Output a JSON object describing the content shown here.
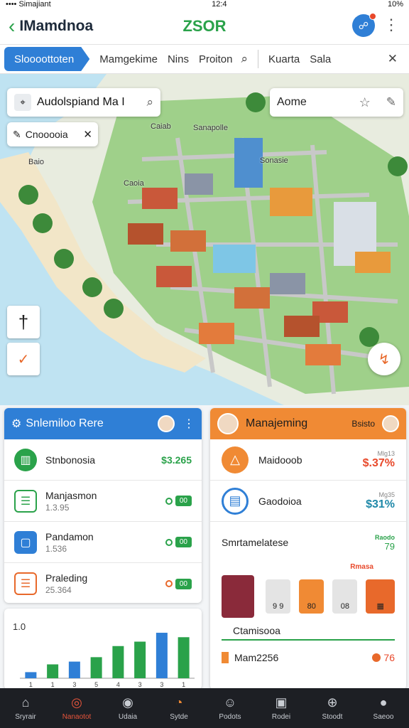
{
  "status_bar": {
    "carrier": "•••• Simajiant",
    "time": "12:4",
    "battery": "10%"
  },
  "app_bar": {
    "title": "IMamdnoa",
    "center_title": "ZSOR"
  },
  "tabs": {
    "active": "Sloooottoten",
    "items": [
      "Mamgekime",
      "Nins",
      "Proiton"
    ],
    "extra": [
      "Kuarta",
      "Sala"
    ]
  },
  "map": {
    "search_text": "Audolspiand Ma I",
    "filter_text": "Cnooooia",
    "place_text": "Aome",
    "labels": [
      "Caiab",
      "Sanapolle",
      "Sonasie",
      "Baio",
      "Caoia"
    ]
  },
  "left_card": {
    "title": "Snlemiloo Rere",
    "rows": [
      {
        "title": "Stnbonosia",
        "sub": "",
        "amount": "$3.265"
      },
      {
        "title": "Manjasmon",
        "sub": "1.3.95",
        "tag": "00"
      },
      {
        "title": "Pandamon",
        "sub": "1.536",
        "tag": "00"
      },
      {
        "title": "Praleding",
        "sub": "25.364",
        "tag": "00"
      }
    ]
  },
  "right_card": {
    "title": "Manajeming",
    "subtitle": "Bsisto",
    "rows": [
      {
        "title": "Maidooob",
        "small": "Mlg13",
        "value": "$.37%",
        "color": "#e8492b"
      },
      {
        "title": "Gaodoioa",
        "small": "Mg35",
        "value": "$31%",
        "color": "#1e88a8"
      }
    ],
    "section_title": "Smrtamelatese",
    "section_value": "Raodo",
    "section_num": "79",
    "tiles_label": "Rmasa",
    "tiles": [
      "9 9",
      "80",
      "08",
      ""
    ],
    "bottom_label": "Ctamisooa",
    "last_row": {
      "text": "Mam2256",
      "value": "76"
    }
  },
  "chart_data": {
    "type": "bar",
    "ylabel": "1.0",
    "categories": [
      "1",
      "1",
      "3",
      "5",
      "4",
      "3",
      "3",
      "1"
    ],
    "values": [
      0.11,
      0.25,
      0.3,
      0.38,
      0.58,
      0.66,
      0.82,
      0.74
    ],
    "colors": [
      "#2f7fd6",
      "#2aa24a",
      "#2f7fd6",
      "#2aa24a",
      "#2aa24a",
      "#2aa24a",
      "#2f7fd6",
      "#2aa24a"
    ],
    "ylim": [
      0,
      1
    ]
  },
  "bottom_nav": [
    {
      "label": "Sryrair",
      "icon": "home-icon"
    },
    {
      "label": "Nanaotot",
      "icon": "target-icon"
    },
    {
      "label": "Udaia",
      "icon": "compass-icon"
    },
    {
      "label": "Sytde",
      "icon": "pie-icon"
    },
    {
      "label": "Podots",
      "icon": "user-icon"
    },
    {
      "label": "Rodei",
      "icon": "calendar-icon"
    },
    {
      "label": "Stoodt",
      "icon": "cart-icon"
    },
    {
      "label": "Saeoo",
      "icon": "profile-icon"
    }
  ]
}
